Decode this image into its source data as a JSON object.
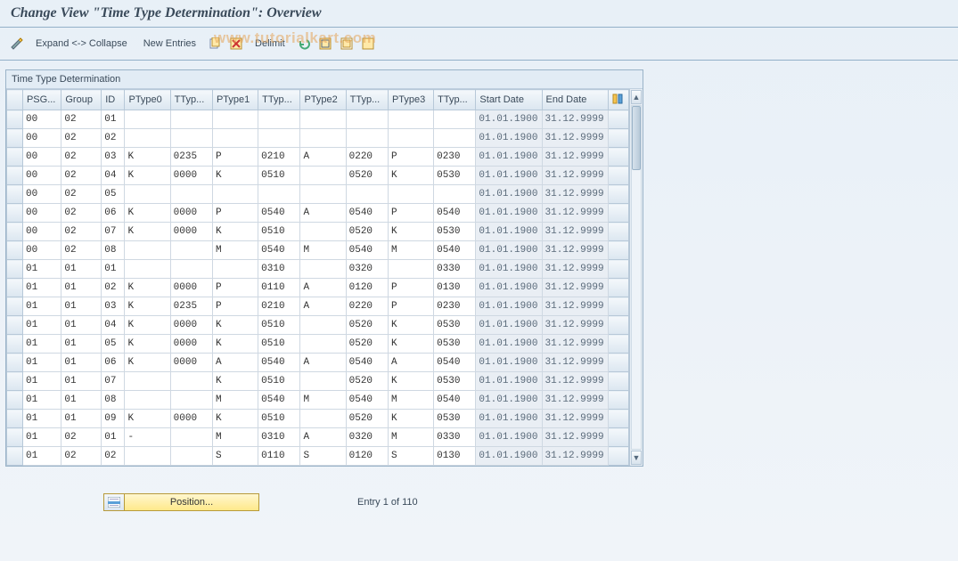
{
  "title": "Change View \"Time Type Determination\": Overview",
  "toolbar": {
    "expand_collapse": "Expand <-> Collapse",
    "new_entries": "New Entries",
    "delimit": "Delimit"
  },
  "watermark": "www.tutorialkart.com",
  "panel": {
    "title": "Time Type Determination",
    "columns": [
      "PSG...",
      "Group",
      "ID",
      "PType0",
      "TTyp...",
      "PType1",
      "TTyp...",
      "PType2",
      "TTyp...",
      "PType3",
      "TTyp...",
      "Start Date",
      "End Date"
    ],
    "rows": [
      {
        "psg": "00",
        "grp": "02",
        "id": "01",
        "pt0": "",
        "tt0": "",
        "pt1": "",
        "tt1": "",
        "pt2": "",
        "tt2": "",
        "pt3": "",
        "tt3": "",
        "sd": "01.01.1900",
        "ed": "31.12.9999"
      },
      {
        "psg": "00",
        "grp": "02",
        "id": "02",
        "pt0": "",
        "tt0": "",
        "pt1": "",
        "tt1": "",
        "pt2": "",
        "tt2": "",
        "pt3": "",
        "tt3": "",
        "sd": "01.01.1900",
        "ed": "31.12.9999"
      },
      {
        "psg": "00",
        "grp": "02",
        "id": "03",
        "pt0": "K",
        "tt0": "0235",
        "pt1": "P",
        "tt1": "0210",
        "pt2": "A",
        "tt2": "0220",
        "pt3": "P",
        "tt3": "0230",
        "sd": "01.01.1900",
        "ed": "31.12.9999"
      },
      {
        "psg": "00",
        "grp": "02",
        "id": "04",
        "pt0": "K",
        "tt0": "0000",
        "pt1": "K",
        "tt1": "0510",
        "pt2": "",
        "tt2": "0520",
        "pt3": "K",
        "tt3": "0530",
        "sd": "01.01.1900",
        "ed": "31.12.9999"
      },
      {
        "psg": "00",
        "grp": "02",
        "id": "05",
        "pt0": "",
        "tt0": "",
        "pt1": "",
        "tt1": "",
        "pt2": "",
        "tt2": "",
        "pt3": "",
        "tt3": "",
        "sd": "01.01.1900",
        "ed": "31.12.9999"
      },
      {
        "psg": "00",
        "grp": "02",
        "id": "06",
        "pt0": "K",
        "tt0": "0000",
        "pt1": "P",
        "tt1": "0540",
        "pt2": "A",
        "tt2": "0540",
        "pt3": "P",
        "tt3": "0540",
        "sd": "01.01.1900",
        "ed": "31.12.9999"
      },
      {
        "psg": "00",
        "grp": "02",
        "id": "07",
        "pt0": "K",
        "tt0": "0000",
        "pt1": "K",
        "tt1": "0510",
        "pt2": "",
        "tt2": "0520",
        "pt3": "K",
        "tt3": "0530",
        "sd": "01.01.1900",
        "ed": "31.12.9999"
      },
      {
        "psg": "00",
        "grp": "02",
        "id": "08",
        "pt0": "",
        "tt0": "",
        "pt1": "M",
        "tt1": "0540",
        "pt2": "M",
        "tt2": "0540",
        "pt3": "M",
        "tt3": "0540",
        "sd": "01.01.1900",
        "ed": "31.12.9999"
      },
      {
        "psg": "01",
        "grp": "01",
        "id": "01",
        "pt0": "",
        "tt0": "",
        "pt1": "",
        "tt1": "0310",
        "pt2": "",
        "tt2": "0320",
        "pt3": "",
        "tt3": "0330",
        "sd": "01.01.1900",
        "ed": "31.12.9999"
      },
      {
        "psg": "01",
        "grp": "01",
        "id": "02",
        "pt0": "K",
        "tt0": "0000",
        "pt1": "P",
        "tt1": "0110",
        "pt2": "A",
        "tt2": "0120",
        "pt3": "P",
        "tt3": "0130",
        "sd": "01.01.1900",
        "ed": "31.12.9999"
      },
      {
        "psg": "01",
        "grp": "01",
        "id": "03",
        "pt0": "K",
        "tt0": "0235",
        "pt1": "P",
        "tt1": "0210",
        "pt2": "A",
        "tt2": "0220",
        "pt3": "P",
        "tt3": "0230",
        "sd": "01.01.1900",
        "ed": "31.12.9999"
      },
      {
        "psg": "01",
        "grp": "01",
        "id": "04",
        "pt0": "K",
        "tt0": "0000",
        "pt1": "K",
        "tt1": "0510",
        "pt2": "",
        "tt2": "0520",
        "pt3": "K",
        "tt3": "0530",
        "sd": "01.01.1900",
        "ed": "31.12.9999"
      },
      {
        "psg": "01",
        "grp": "01",
        "id": "05",
        "pt0": "K",
        "tt0": "0000",
        "pt1": "K",
        "tt1": "0510",
        "pt2": "",
        "tt2": "0520",
        "pt3": "K",
        "tt3": "0530",
        "sd": "01.01.1900",
        "ed": "31.12.9999"
      },
      {
        "psg": "01",
        "grp": "01",
        "id": "06",
        "pt0": "K",
        "tt0": "0000",
        "pt1": "A",
        "tt1": "0540",
        "pt2": "A",
        "tt2": "0540",
        "pt3": "A",
        "tt3": "0540",
        "sd": "01.01.1900",
        "ed": "31.12.9999"
      },
      {
        "psg": "01",
        "grp": "01",
        "id": "07",
        "pt0": "",
        "tt0": "",
        "pt1": "K",
        "tt1": "0510",
        "pt2": "",
        "tt2": "0520",
        "pt3": "K",
        "tt3": "0530",
        "sd": "01.01.1900",
        "ed": "31.12.9999"
      },
      {
        "psg": "01",
        "grp": "01",
        "id": "08",
        "pt0": "",
        "tt0": "",
        "pt1": "M",
        "tt1": "0540",
        "pt2": "M",
        "tt2": "0540",
        "pt3": "M",
        "tt3": "0540",
        "sd": "01.01.1900",
        "ed": "31.12.9999"
      },
      {
        "psg": "01",
        "grp": "01",
        "id": "09",
        "pt0": "K",
        "tt0": "0000",
        "pt1": "K",
        "tt1": "0510",
        "pt2": "",
        "tt2": "0520",
        "pt3": "K",
        "tt3": "0530",
        "sd": "01.01.1900",
        "ed": "31.12.9999"
      },
      {
        "psg": "01",
        "grp": "02",
        "id": "01",
        "pt0": "-",
        "tt0": "",
        "pt1": "M",
        "tt1": "0310",
        "pt2": "A",
        "tt2": "0320",
        "pt3": "M",
        "tt3": "0330",
        "sd": "01.01.1900",
        "ed": "31.12.9999"
      },
      {
        "psg": "01",
        "grp": "02",
        "id": "02",
        "pt0": "",
        "tt0": "",
        "pt1": "S",
        "tt1": "0110",
        "pt2": "S",
        "tt2": "0120",
        "pt3": "S",
        "tt3": "0130",
        "sd": "01.01.1900",
        "ed": "31.12.9999"
      }
    ]
  },
  "footer": {
    "position_label": "Position...",
    "entry_text": "Entry 1 of 110"
  }
}
